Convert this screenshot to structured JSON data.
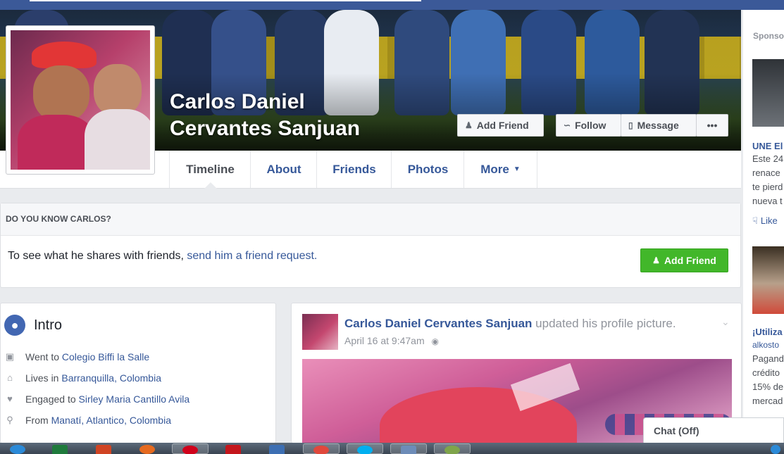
{
  "profile": {
    "name": "Carlos Daniel Cervantes Sanjuan",
    "name_line1": "Carlos Daniel",
    "name_line2": "Cervantes Sanjuan"
  },
  "cover_actions": {
    "add_friend": "Add Friend",
    "follow": "Follow",
    "message": "Message",
    "more": "•••"
  },
  "tabs": [
    {
      "label": "Timeline",
      "active": true
    },
    {
      "label": "About"
    },
    {
      "label": "Friends"
    },
    {
      "label": "Photos"
    },
    {
      "label": "More",
      "has_dropdown": true
    }
  ],
  "know": {
    "header": "DO YOU KNOW CARLOS?",
    "text_prefix": "To see what he shares with friends, ",
    "link": "send him a friend request.",
    "button": "Add Friend"
  },
  "intro": {
    "title": "Intro",
    "items": [
      {
        "icon": "school-icon",
        "prefix": "Went to ",
        "value": "Colegio Biffi la Salle"
      },
      {
        "icon": "home-icon",
        "prefix": "Lives in ",
        "value": "Barranquilla, Colombia"
      },
      {
        "icon": "heart-icon",
        "prefix": "Engaged to ",
        "value": "Sirley Maria Cantillo Avila"
      },
      {
        "icon": "location-pin-icon",
        "prefix": "From ",
        "value": "Manatí, Atlantico, Colombia"
      }
    ]
  },
  "post": {
    "author": "Carlos Daniel Cervantes Sanjuan",
    "action": " updated his profile picture.",
    "date": "April 16 at 9:47am",
    "audience_icon": "globe-icon"
  },
  "sidebar": {
    "title": "Sponso",
    "ad1": {
      "headline": "UNE El",
      "lines": [
        "Este 24",
        "renace",
        "te pierd",
        "nueva t"
      ],
      "like": "Like"
    },
    "ad2": {
      "headline": "¡Utiliza",
      "source": "alkosto",
      "lines": [
        "Pagand",
        "crédito",
        "15% de",
        "mercad"
      ]
    }
  },
  "chat": {
    "label": "Chat (Off)"
  },
  "colors": {
    "facebook_blue": "#3b5998",
    "link_blue": "#365899",
    "green_button": "#42b72a"
  }
}
